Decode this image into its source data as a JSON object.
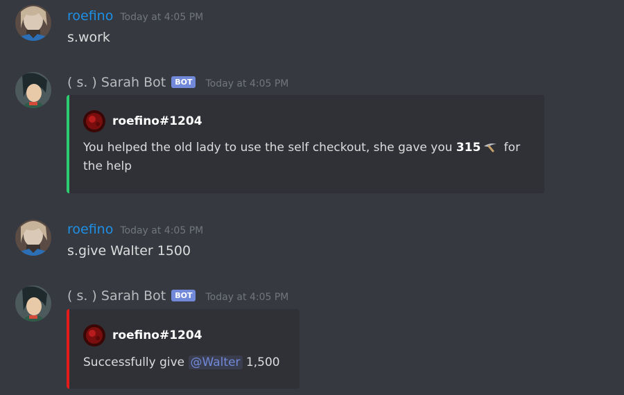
{
  "messages": [
    {
      "username": "roefino",
      "timestamp": "Today at 4:05 PM",
      "text": "s.work"
    },
    {
      "username": "( s. ) Sarah Bot",
      "bot_tag": "BOT",
      "timestamp": "Today at 4:05 PM",
      "embed": {
        "accent_color": "#2ecc71",
        "author": "roefino#1204",
        "desc_before": "You helped the old lady to use the self checkout, she gave you ",
        "amount": "315",
        "coin_icon": "pickaxe-icon",
        "desc_line1_after": " for",
        "desc_line2": "the help"
      }
    },
    {
      "username": "roefino",
      "timestamp": "Today at 4:05 PM",
      "text": "s.give Walter 1500"
    },
    {
      "username": "( s. ) Sarah Bot",
      "bot_tag": "BOT",
      "timestamp": "Today at 4:05 PM",
      "embed": {
        "accent_color": "#e41b1b",
        "author": "roefino#1204",
        "desc_before": "Successfully give ",
        "mention": "@Walter",
        "desc_after": " 1,500"
      }
    }
  ],
  "colors": {
    "background": "#36393f",
    "embed_background": "#2f3136",
    "user_name": "#1e90e6",
    "bot_tag": "#7289da",
    "mention": "#7289da"
  }
}
